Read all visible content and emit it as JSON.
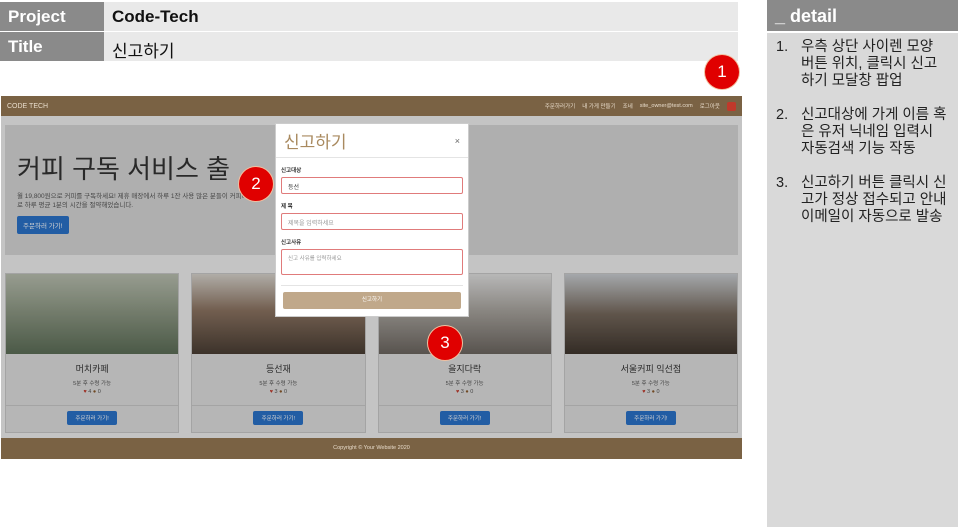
{
  "header": {
    "project_key": "Project",
    "project_value": "Code-Tech",
    "title_key": "Title",
    "title_value": "신고하기"
  },
  "detail": {
    "title": "_ detail",
    "items": [
      {
        "num": "1.",
        "text": "우측 상단 사이렌 모양 버튼 위치, 클릭시 신고하기 모달창 팝업"
      },
      {
        "num": "2.",
        "text": "신고대상에 가게 이름 혹은 유저 닉네임 입력시 자동검색 기능 작동"
      },
      {
        "num": "3.",
        "text": "신고하기 버튼 클릭시 신고가 정상 접수되고 안내 이메일이 자동으로 발송"
      }
    ]
  },
  "markers": [
    "1",
    "2",
    "3"
  ],
  "app": {
    "brand": "CODE TECH",
    "nav_links": [
      "주문하러가기",
      "내 가게 만들기",
      "조네",
      "site_owner@test.com",
      "로그아웃"
    ],
    "hero": {
      "title": "커피 구독 서비스 출",
      "subtitle": "월 19,800원으로 커피를 구독하세요! 제휴 매장에서 하루 1잔 사용 많은 분들이 커피타크로 하루 평균 1분의 시간을 절약해었습니다.",
      "button": "주문하러 가기!"
    },
    "cards": [
      {
        "name": "머치카페",
        "meta": "5분 후 수령 가능",
        "hearts": "4",
        "beans": "0",
        "button": "주문하러 가기!"
      },
      {
        "name": "등선재",
        "meta": "5분 후 수령 가능",
        "hearts": "3",
        "beans": "0",
        "button": "주문하러 가기!"
      },
      {
        "name": "을지다락",
        "meta": "5분 후 수령 가능",
        "hearts": "3",
        "beans": "0",
        "button": "주문하러 가기!"
      },
      {
        "name": "서울커피 익선점",
        "meta": "5분 후 수령 가능",
        "hearts": "3",
        "beans": "0",
        "button": "주문하러 가기!"
      }
    ],
    "footer": "Copyright © Your Website 2020"
  },
  "modal": {
    "title": "신고하기",
    "close": "×",
    "target_label": "신고대상",
    "target_value": "등선",
    "subject_label": "제 목",
    "subject_placeholder": "제목을 입력하세요",
    "reason_label": "신고사유",
    "reason_placeholder": "신고 사유를 입력하세요",
    "submit": "신고하기"
  }
}
